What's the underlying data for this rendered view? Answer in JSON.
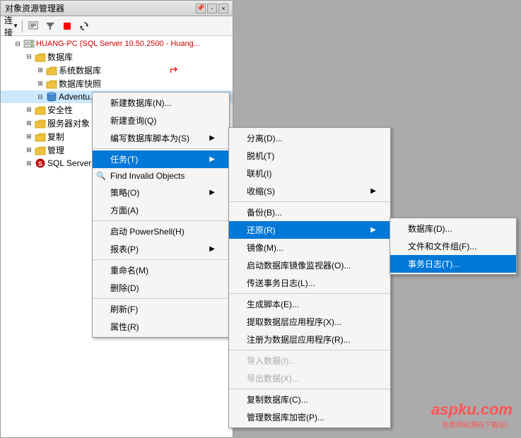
{
  "panel": {
    "title": "对象资源管理器",
    "title_buttons": [
      "-",
      "×"
    ]
  },
  "toolbar": {
    "buttons": [
      "连接",
      "▼",
      "⚡",
      "📋",
      "▣",
      "⊟",
      "🔍",
      "⚙"
    ]
  },
  "tree": {
    "root_label": "HUANG-PC (SQL Server 10.50.2500 - Huang...",
    "items": [
      {
        "label": "数据库",
        "level": 1,
        "expanded": true
      },
      {
        "label": "系统数据库",
        "level": 2
      },
      {
        "label": "数据库快照",
        "level": 2
      },
      {
        "label": "Adventu...",
        "level": 2,
        "selected": true
      },
      {
        "label": "安全性",
        "level": 1
      },
      {
        "label": "服务器对象",
        "level": 1
      },
      {
        "label": "复制",
        "level": 1
      },
      {
        "label": "管理",
        "level": 1
      },
      {
        "label": "SQL Server...",
        "level": 1
      }
    ]
  },
  "context_menu_main": {
    "items": [
      {
        "label": "新建数据库(N)...",
        "disabled": false,
        "has_submenu": false
      },
      {
        "label": "新建查询(Q)",
        "disabled": false,
        "has_submenu": false
      },
      {
        "label": "编写数据库脚本为(S)",
        "disabled": false,
        "has_submenu": true
      },
      {
        "label": "任务(T)",
        "disabled": false,
        "has_submenu": true,
        "active": true
      },
      {
        "label": "Find Invalid Objects",
        "disabled": false,
        "has_submenu": false,
        "has_icon": true
      },
      {
        "label": "策略(O)",
        "disabled": false,
        "has_submenu": true
      },
      {
        "label": "方面(A)",
        "disabled": false,
        "has_submenu": false
      },
      {
        "label": "启动 PowerShell(H)",
        "disabled": false,
        "has_submenu": false
      },
      {
        "label": "报表(P)",
        "disabled": false,
        "has_submenu": true
      },
      {
        "label": "重命名(M)",
        "disabled": false,
        "has_submenu": false
      },
      {
        "label": "删除(D)",
        "disabled": false,
        "has_submenu": false
      },
      {
        "label": "刷新(F)",
        "disabled": false,
        "has_submenu": false
      },
      {
        "label": "属性(R)",
        "disabled": false,
        "has_submenu": false
      }
    ]
  },
  "context_menu_tasks": {
    "items": [
      {
        "label": "分离(D)...",
        "disabled": false
      },
      {
        "label": "脱机(T)",
        "disabled": false
      },
      {
        "label": "联机(I)",
        "disabled": false
      },
      {
        "label": "收缩(S)",
        "disabled": false,
        "has_submenu": true
      },
      {
        "label": "备份(B)...",
        "disabled": false
      },
      {
        "label": "还原(R)",
        "disabled": false,
        "has_submenu": true,
        "active": true
      },
      {
        "label": "镜像(M)...",
        "disabled": false
      },
      {
        "label": "启动数据库镜像监视器(O)...",
        "disabled": false
      },
      {
        "label": "传送事务日志(L)...",
        "disabled": false
      },
      {
        "label": "生成脚本(E)...",
        "disabled": false
      },
      {
        "label": "提取数据层应用程序(X)...",
        "disabled": false
      },
      {
        "label": "注册为数据层应用程序(R)...",
        "disabled": false
      },
      {
        "label": "导入数据(I)...",
        "disabled": true
      },
      {
        "label": "导出数据(X)...",
        "disabled": true
      },
      {
        "label": "复制数据库(C)...",
        "disabled": false
      },
      {
        "label": "管理数据库加密(P)...",
        "disabled": false
      }
    ]
  },
  "context_menu_restore": {
    "items": [
      {
        "label": "数据库(D)...",
        "disabled": false
      },
      {
        "label": "文件和文件组(F)...",
        "disabled": false
      },
      {
        "label": "事务日志(T)...",
        "disabled": false,
        "active": true
      }
    ]
  },
  "watermark": {
    "main": "aspku.com",
    "sub": "免费网站源码下载站！"
  }
}
